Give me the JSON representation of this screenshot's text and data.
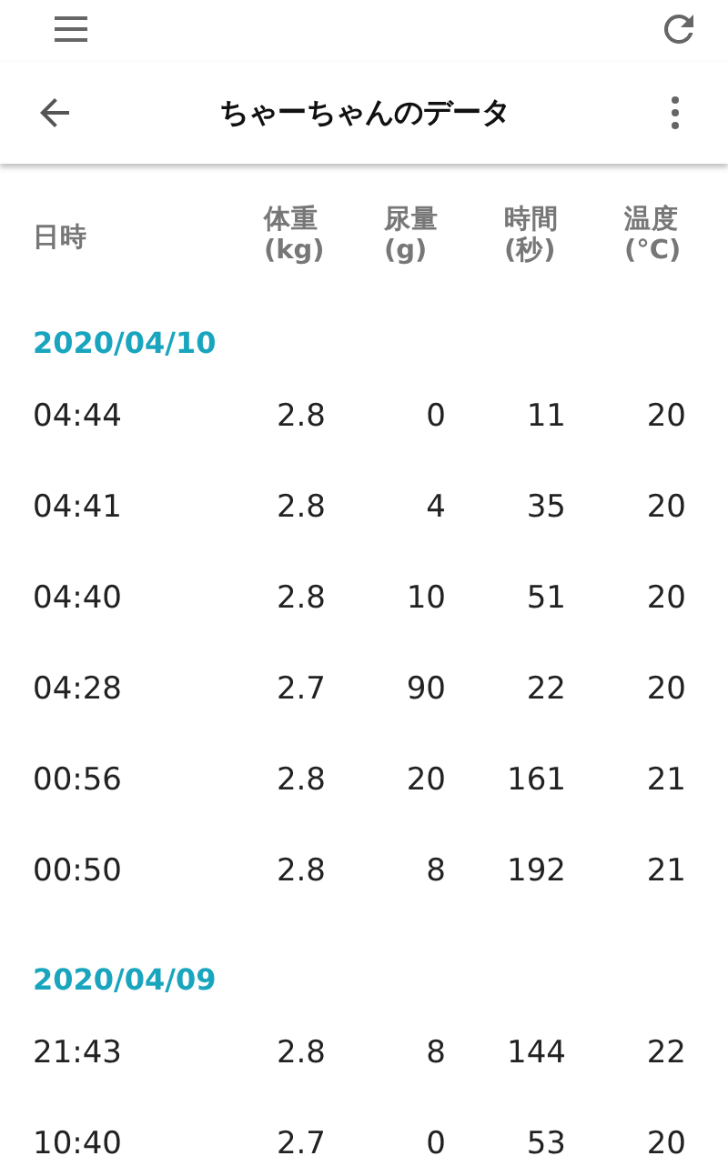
{
  "app_bar": {
    "title": "ちゃーちゃんのデータ"
  },
  "table": {
    "columns": [
      {
        "label": "日時"
      },
      {
        "label": "体重",
        "unit": "(kg)"
      },
      {
        "label": "尿量",
        "unit": "(g)"
      },
      {
        "label": "時間",
        "unit": "(秒)"
      },
      {
        "label": "温度",
        "unit": "(°C)"
      }
    ],
    "groups": [
      {
        "date": "2020/04/10",
        "rows": [
          [
            "04:44",
            "2.8",
            "0",
            "11",
            "20"
          ],
          [
            "04:41",
            "2.8",
            "4",
            "35",
            "20"
          ],
          [
            "04:40",
            "2.8",
            "10",
            "51",
            "20"
          ],
          [
            "04:28",
            "2.7",
            "90",
            "22",
            "20"
          ],
          [
            "00:56",
            "2.8",
            "20",
            "161",
            "21"
          ],
          [
            "00:50",
            "2.8",
            "8",
            "192",
            "21"
          ]
        ]
      },
      {
        "date": "2020/04/09",
        "rows": [
          [
            "21:43",
            "2.8",
            "8",
            "144",
            "22"
          ],
          [
            "10:40",
            "2.7",
            "0",
            "53",
            "20"
          ]
        ]
      }
    ]
  }
}
